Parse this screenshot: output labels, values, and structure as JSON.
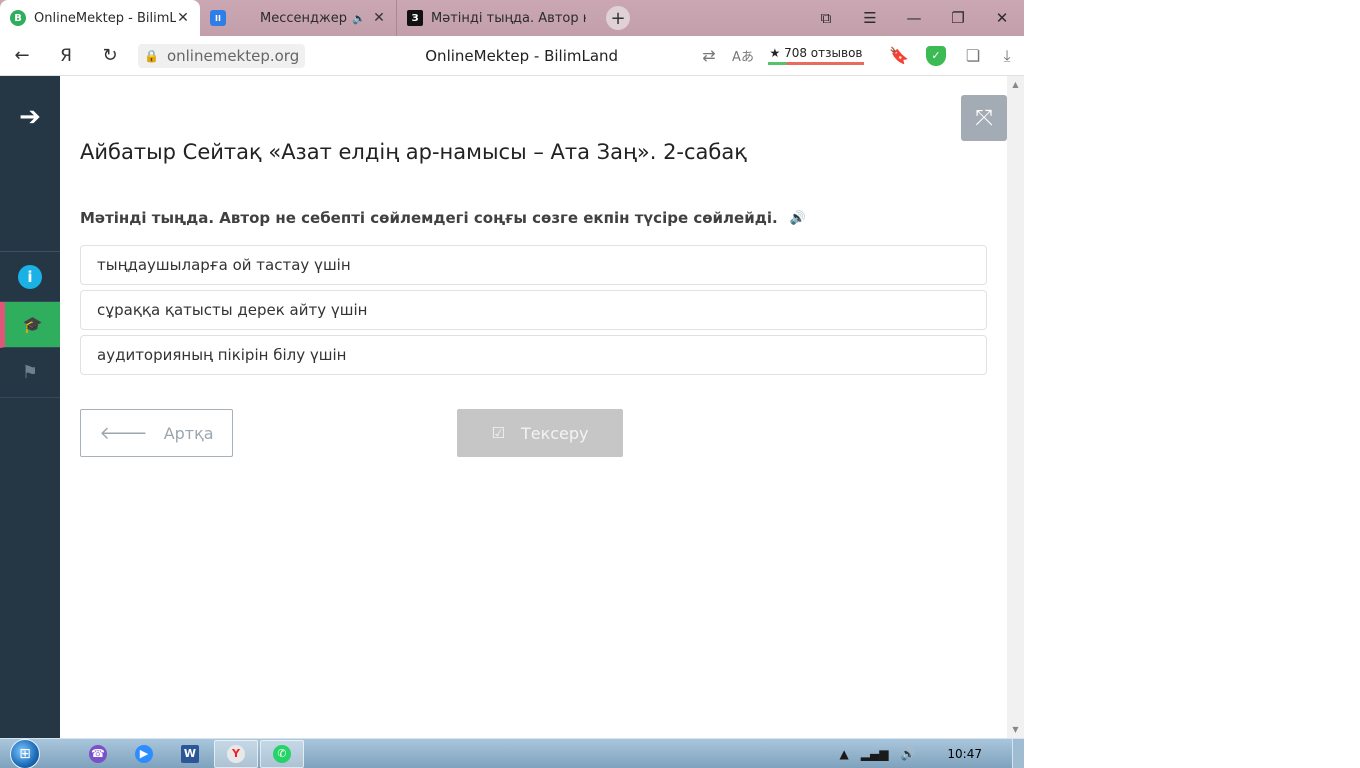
{
  "browser": {
    "tabs": [
      {
        "title": "OnlineMektep - BilimLand",
        "favicon": "B",
        "color": "#2fae5d"
      },
      {
        "title": "Мессенджер",
        "favicon": "II",
        "color": "#2f7ee6"
      },
      {
        "title": "Мәтінді тыңда. Автор не с",
        "favicon": "З",
        "color": "#111111"
      }
    ],
    "url": "onlinemektep.org",
    "page_title": "OnlineMektep - BilimLand",
    "reviews": "★ 708 отзывов"
  },
  "lesson": {
    "title": "Айбатыр Сейтақ «Азат елдің ар-намысы – Ата Заң». 2-сабақ",
    "question": "Мәтінді тыңда. Автор не себепті сөйлемдегі соңғы сөзге екпін түсіре сөйлейді.",
    "answers": [
      "тыңдаушыларға ой тастау үшін",
      "сұраққа қатысты дерек айту үшін",
      "аудиторияның пікірін білу үшін"
    ],
    "back_label": "Артқа",
    "check_label": "Тексеру"
  },
  "taskbar": {
    "time": "10:47"
  }
}
